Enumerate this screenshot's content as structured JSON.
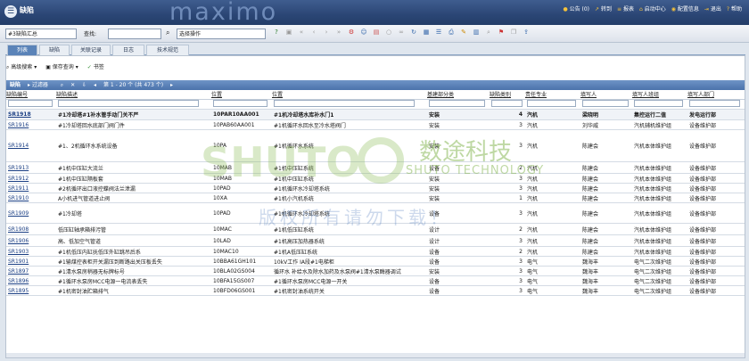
{
  "header": {
    "app_title": "缺陷",
    "brand": "maximo",
    "nav": [
      "公告 (0)",
      "转到",
      "报表",
      "启动中心",
      "配置信息",
      "退出",
      "帮助"
    ]
  },
  "toolbar": {
    "app_select": "#3缺陷汇总",
    "find_label": "查找:",
    "action_select": "选择操作"
  },
  "tabs": [
    "列表",
    "缺陷",
    "关联记录",
    "日志",
    "技术规范"
  ],
  "subbar": {
    "advanced_search": "高级搜索",
    "save_query": "保存查询",
    "bookmark": "书签"
  },
  "listbar": {
    "label": "缺陷",
    "filter": "过滤器",
    "pager": "第 1 - 20 个 (共 473 个)"
  },
  "columns": [
    "缺陷编号",
    "缺陷描述",
    "位置",
    "位置",
    "基建部分类",
    "缺陷类别",
    "责任专业",
    "填写人",
    "填写人班组",
    "填写人部门"
  ],
  "rows": [
    {
      "id": "SR1918",
      "desc": "#1冷却塔#1补水管手动门关不严",
      "loc": "10PAR10AA001",
      "locdesc": "#1机冷却塔水库补水门1",
      "cls": "安装",
      "cat": "4",
      "spec": "汽机",
      "who": "梁晓明",
      "group": "集控运行二值",
      "dept": "发电运行部"
    },
    {
      "id": "SR1916",
      "desc": "#1冷却塔回水底部门阀门件",
      "loc": "10PAB60AA001",
      "locdesc": "#1机循环水回水至冷水塔阀门",
      "cls": "安装",
      "cat": "3",
      "spec": "汽机",
      "who": "刘华威",
      "group": "汽机辅机维护组",
      "dept": "设备维护部"
    },
    {
      "id": "SR1914",
      "desc": "#1、2机循环水系统设备",
      "loc": "10PA",
      "locdesc": "#1机循环水系统",
      "cls": "安装",
      "cat": "3",
      "spec": "汽机",
      "who": "陈建会",
      "group": "汽机本体维护组",
      "dept": "设备维护部"
    },
    {
      "id": "SR1913",
      "desc": "#1机中压缸大流兰",
      "loc": "10MAB",
      "locdesc": "#1机中压缸系统",
      "cls": "设备",
      "cat": "2",
      "spec": "汽机",
      "who": "陈建会",
      "group": "汽机本体维护组",
      "dept": "设备维护部"
    },
    {
      "id": "SR1912",
      "desc": "#1机中压缸隔板套",
      "loc": "10MAB",
      "locdesc": "#1机中压缸系统",
      "cls": "安装",
      "cat": "3",
      "spec": "汽机",
      "who": "陈建会",
      "group": "汽机本体维护组",
      "dept": "设备维护部"
    },
    {
      "id": "SR1911",
      "desc": "#2机循环出口液控蝶阀法兰泄漏",
      "loc": "10PAD",
      "locdesc": "#1机循环水冷却塔系统",
      "cls": "安装",
      "cat": "3",
      "spec": "汽机",
      "who": "陈建会",
      "group": "汽机本体维护组",
      "dept": "设备维护部"
    },
    {
      "id": "SR1910",
      "desc": "A小机进气管道进止阀",
      "loc": "10XA",
      "locdesc": "#1机小汽机系统",
      "cls": "安装",
      "cat": "1",
      "spec": "汽机",
      "who": "陈建会",
      "group": "汽机本体维护组",
      "dept": "设备维护部"
    },
    {
      "id": "SR1909",
      "desc": "#1冷却塔",
      "loc": "10PAD",
      "locdesc": "#1机循环水冷却塔系统",
      "cls": "设备",
      "cat": "3",
      "spec": "汽机",
      "who": "陈建会",
      "group": "汽机本体维护组",
      "dept": "设备维护部"
    },
    {
      "id": "SR1908",
      "desc": "低压缸轴承箱排污管",
      "loc": "10MAC",
      "locdesc": "#1机低压缸系统",
      "cls": "设计",
      "cat": "2",
      "spec": "汽机",
      "who": "陈建会",
      "group": "汽机本体维护组",
      "dept": "设备维护部"
    },
    {
      "id": "SR1906",
      "desc": "高、低加空气管道",
      "loc": "10LAD",
      "locdesc": "#1机高压加热器系统",
      "cls": "设计",
      "cat": "3",
      "spec": "汽机",
      "who": "陈建会",
      "group": "汽机本体维护组",
      "dept": "设备维护部"
    },
    {
      "id": "SR1903",
      "desc": "#1机低压内缸抚低压外缸跳吊后系",
      "loc": "10MAC10",
      "locdesc": "#1机A低压缸系统",
      "cls": "设备",
      "cat": "2",
      "spec": "汽机",
      "who": "陈建会",
      "group": "汽机本体维护组",
      "dept": "设备维护部"
    },
    {
      "id": "SR1901",
      "desc": "#1输煤控表柜开关漏压到断路出关压板丢失",
      "loc": "10BBA61GH101",
      "locdesc": "10kV工作 IA段#1电梯柜",
      "cls": "设备",
      "cat": "3",
      "spec": "电气",
      "who": "魏海丰",
      "group": "电气二次维护组",
      "dept": "设备维护部"
    },
    {
      "id": "SR1897",
      "desc": "#1清水泵房稍器无标牌标号",
      "loc": "10BLA02GS004",
      "locdesc": "循环水 补给水及除水加药及水泵阀#1清水泵酶器调试",
      "cls": "安装",
      "cat": "3",
      "spec": "电气",
      "who": "魏海丰",
      "group": "电气二次维护组",
      "dept": "设备维护部"
    },
    {
      "id": "SR1896",
      "desc": "#1循环水泵房MCC电源一电流表丢失",
      "loc": "10BFA15GS007",
      "locdesc": "#1循环水泵房MCC电源一开关",
      "cls": "设备",
      "cat": "3",
      "spec": "电气",
      "who": "魏海丰",
      "group": "电气二次维护组",
      "dept": "设备维护部"
    },
    {
      "id": "SR1895",
      "desc": "#1机密封油贮箱排气",
      "loc": "10BFD06GS001",
      "locdesc": "#1机密封油系统开关",
      "cls": "设备",
      "cat": "3",
      "spec": "电气",
      "who": "魏海丰",
      "group": "电气二次维护组",
      "dept": "设备维护部"
    }
  ],
  "watermark": {
    "brand_cn": "数途科技",
    "brand_en": "SHUTO TECHNOLOGY",
    "mark": "SHUTO",
    "note": "版权所有请勿下载！"
  }
}
